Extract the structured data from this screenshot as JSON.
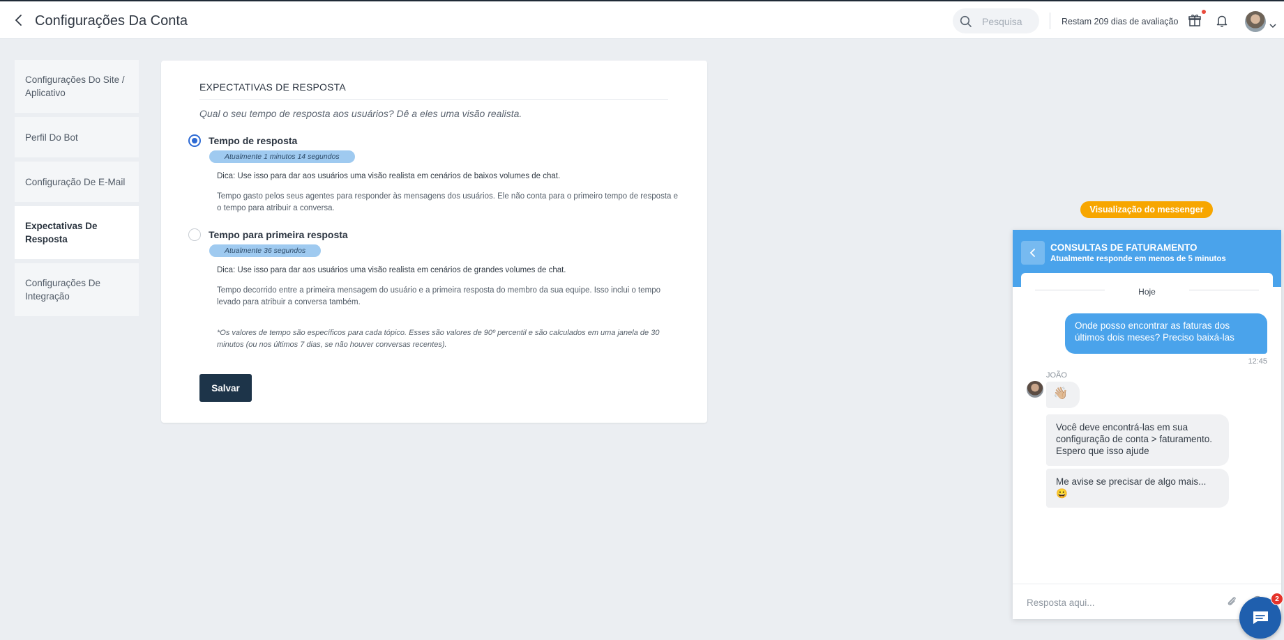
{
  "header": {
    "title": "Configurações Da Conta",
    "search_placeholder": "Pesquisa",
    "trial_text": "Restam 209 dias de avaliação",
    "icons": [
      "back-arrow-icon",
      "search-icon",
      "gift-icon",
      "bell-icon",
      "chevron-down-icon"
    ]
  },
  "sidebar": {
    "items": [
      {
        "label": "Configurações Do Site / Aplicativo",
        "active": false
      },
      {
        "label": "Perfil Do Bot",
        "active": false
      },
      {
        "label": "Configuração De E-Mail",
        "active": false
      },
      {
        "label": "Expectativas De Resposta",
        "active": true
      },
      {
        "label": "Configurações De Integração",
        "active": false
      }
    ]
  },
  "main": {
    "section_title": "EXPECTATIVAS DE RESPOSTA",
    "question": "Qual o seu tempo de resposta aos usuários? Dê a eles uma visão realista.",
    "options": [
      {
        "label": "Tempo de resposta",
        "selected": true,
        "current": "Atualmente 1 minutos 14 segundos",
        "tip": "Dica: Use isso para dar aos usuários uma visão realista em cenários de baixos volumes de chat.",
        "description": "Tempo gasto pelos seus agentes para responder às mensagens dos usuários. Ele não conta para o primeiro tempo de resposta e o tempo para atribuir a conversa."
      },
      {
        "label": "Tempo para primeira resposta",
        "selected": false,
        "current": "Atualmente 36 segundos",
        "tip": "Dica: Use isso para dar aos usuários uma visão realista em cenários de grandes volumes de chat.",
        "description": "Tempo decorrido entre a primeira mensagem do usuário e a primeira resposta do membro da sua equipe. Isso inclui o tempo levado para atribuir a conversa também."
      }
    ],
    "footnote": "*Os valores de tempo são específicos para cada tópico. Esses são valores de 90º percentil e são calculados em uma janela de 30 minutos (ou nos últimos 7 dias, se não houver conversas recentes).",
    "save_label": "Salvar"
  },
  "messenger": {
    "preview_badge": "Visualização do messenger",
    "title": "CONSULTAS DE FATURAMENTO",
    "subtitle": "Atualmente responde em menos de 5 minutos",
    "day_label": "Hoje",
    "user_message": "Onde posso encontrar as faturas dos últimos dois meses? Preciso baixá-las",
    "user_message_time": "12:45",
    "agent_name": "JOÃO",
    "agent_messages": [
      "👋🏼",
      "Você deve encontrá-las em sua configuração de conta > faturamento. Espero que isso ajude",
      "Me avise se precisar de algo mais... 😀"
    ],
    "input_placeholder": "Resposta aqui...",
    "launcher_badge": "2",
    "colors": {
      "header": "#4aa3eb",
      "badge": "#f7a600",
      "launcher": "#1f5fae"
    }
  }
}
